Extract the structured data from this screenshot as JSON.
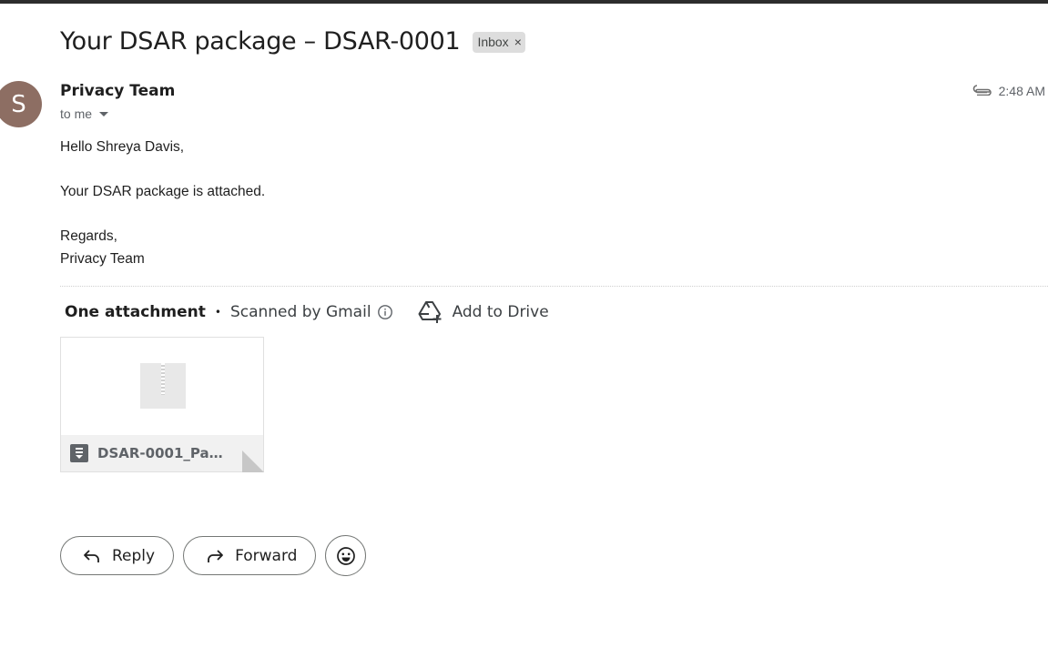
{
  "subject": "Your DSAR package – DSAR-0001",
  "label_chip": {
    "text": "Inbox",
    "remove": "×"
  },
  "sender": {
    "avatar_letter": "S",
    "avatar_color": "#8d6e63",
    "name": "Privacy Team",
    "recipient": "to me",
    "time": "2:48 AM"
  },
  "body": {
    "greeting": "Hello Shreya Davis,",
    "line1": "Your DSAR package is attached.",
    "closing": "Regards,",
    "signature": "Privacy Team"
  },
  "attachments": {
    "count_label": "One attachment",
    "separator": "•",
    "scanned_label": "Scanned by Gmail",
    "add_to_drive": "Add to Drive",
    "files": [
      {
        "name": "DSAR-0001_Pack...",
        "icon": "archive-file-icon"
      }
    ]
  },
  "actions": {
    "reply": "Reply",
    "forward": "Forward",
    "emoji_icon": "emoji-smile-icon"
  }
}
